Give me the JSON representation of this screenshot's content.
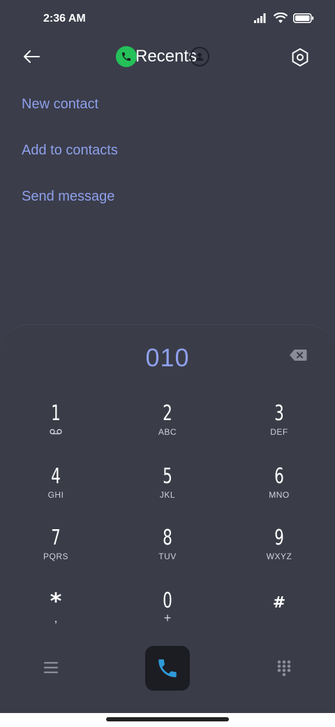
{
  "status_bar": {
    "time": "2:36 AM"
  },
  "header": {
    "title": "Recents"
  },
  "menu": {
    "items": [
      "New contact",
      "Add to contacts",
      "Send message"
    ]
  },
  "dialer": {
    "number": "010",
    "keys": [
      {
        "digit": "1",
        "letters": ""
      },
      {
        "digit": "2",
        "letters": "ABC"
      },
      {
        "digit": "3",
        "letters": "DEF"
      },
      {
        "digit": "4",
        "letters": "GHI"
      },
      {
        "digit": "5",
        "letters": "JKL"
      },
      {
        "digit": "6",
        "letters": "MNO"
      },
      {
        "digit": "7",
        "letters": "PQRS"
      },
      {
        "digit": "8",
        "letters": "TUV"
      },
      {
        "digit": "9",
        "letters": "WXYZ"
      },
      {
        "digit": "*",
        "letters": ","
      },
      {
        "digit": "0",
        "letters": "+"
      },
      {
        "digit": "#",
        "letters": ""
      }
    ]
  },
  "colors": {
    "background": "#3b3d4a",
    "accent": "#8ea0ec",
    "call_green": "#25c05a",
    "call_icon_blue": "#2f9ad8"
  }
}
